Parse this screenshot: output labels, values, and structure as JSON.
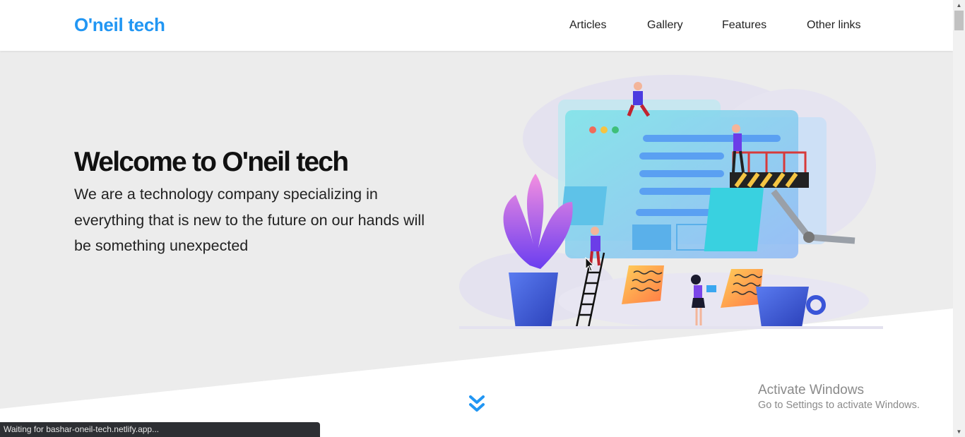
{
  "header": {
    "logo": "O'neil tech",
    "nav": [
      {
        "label": "Articles"
      },
      {
        "label": "Gallery"
      },
      {
        "label": "Features"
      },
      {
        "label": "Other links"
      }
    ]
  },
  "hero": {
    "title": "Welcome to O'neil tech",
    "description": "We are a technology company specializing in everything that is new to the future on our hands will be something unexpected"
  },
  "scroll_down_icon": "chevron-double-down",
  "watermark": {
    "title": "Activate Windows",
    "subtitle": "Go to Settings to activate Windows."
  },
  "status_bar": {
    "text": "Waiting for bashar-oneil-tech.netlify.app..."
  },
  "colors": {
    "brand": "#2196f3",
    "hero_bg": "#ececec",
    "text": "#111111"
  }
}
